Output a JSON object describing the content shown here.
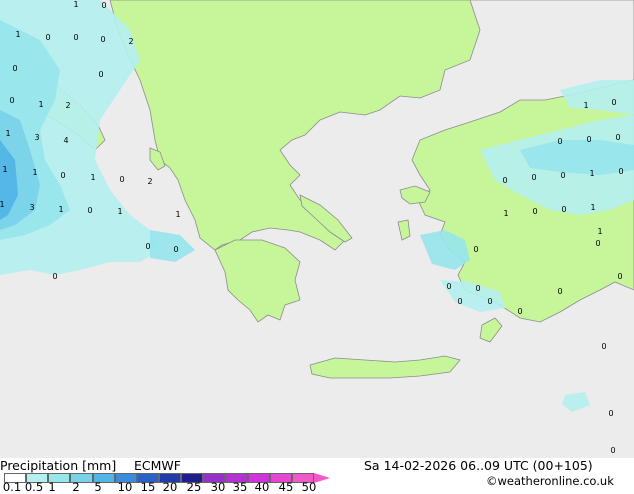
{
  "map": {
    "point_labels": [
      "1",
      "0",
      "1",
      "0",
      "0",
      "0",
      "2",
      "0",
      "0",
      "0",
      "1",
      "2",
      "1",
      "3",
      "4",
      "1",
      "1",
      "0",
      "1",
      "0",
      "2",
      "1",
      "3",
      "1",
      "0",
      "1",
      "1",
      "0",
      "0",
      "0",
      "0",
      "0",
      "0",
      "1",
      "0",
      "0",
      "1",
      "0",
      "0",
      "1",
      "1",
      "0",
      "0",
      "0",
      "0",
      "1",
      "0",
      "0",
      "0",
      "0",
      "0",
      "0",
      "0",
      "0",
      "0",
      "0",
      "0"
    ]
  },
  "footer": {
    "title": "Precipitation [mm]",
    "model": "ECMWF",
    "datetime": "Sa 14-02-2026 06..09 UTC (00+105)",
    "credit": "©weatheronline.co.uk",
    "scale_ticks": [
      "0.1",
      "0.5",
      "1",
      "2",
      "5",
      "10",
      "15",
      "20",
      "25",
      "30",
      "35",
      "40",
      "45",
      "50"
    ],
    "scale_colors": [
      "#ffffff",
      "#b4f0f0",
      "#96e6ec",
      "#78d2e8",
      "#50b4e6",
      "#3c8cdc",
      "#2864c8",
      "#1e3caa",
      "#1e1e8c",
      "#9632c8",
      "#b432d2",
      "#d232dc",
      "#e646d2",
      "#f05ac8"
    ]
  }
}
